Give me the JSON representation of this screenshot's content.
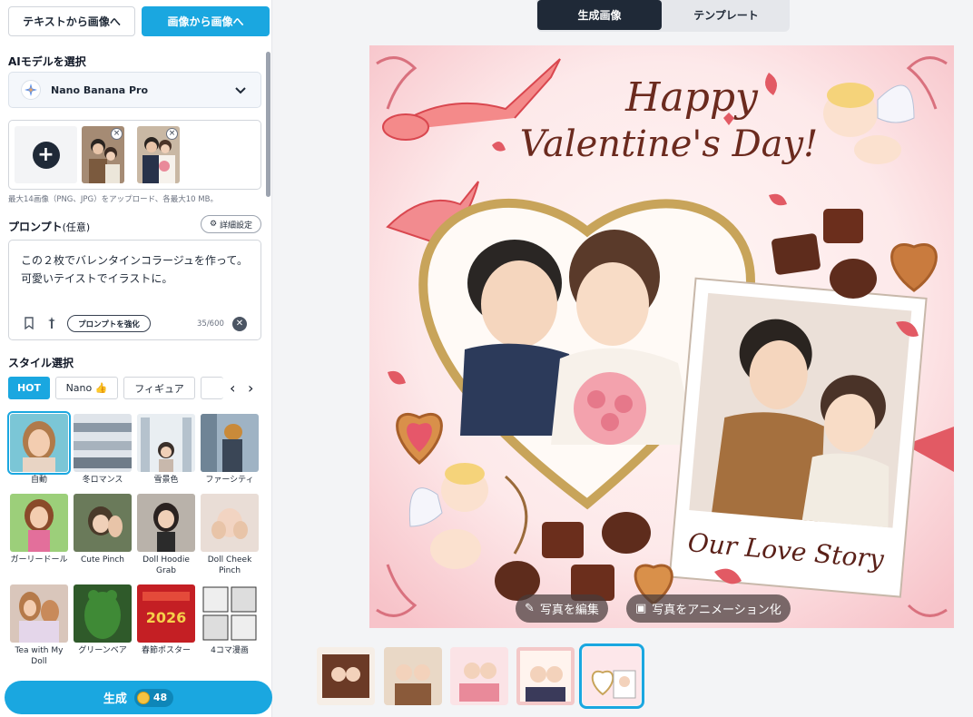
{
  "mode_tabs": {
    "text_to_image": "テキストから画像へ",
    "image_to_image": "画像から画像へ"
  },
  "model": {
    "section_label": "AIモデルを選択",
    "selected": "Nano Banana Pro"
  },
  "upload": {
    "note": "最大14画像（PNG、JPG）をアップロード、各最大10 MB。",
    "thumbnail_count": 2
  },
  "prompt": {
    "label": "プロンプト",
    "optional": "(任意)",
    "detail_settings": "詳細設定",
    "text": "この２枚でバレンタインコラージュを作って。可愛いテイストでイラストに。",
    "enhance_label": "プロンプトを強化",
    "counter": "35/600"
  },
  "style": {
    "section_label": "スタイル選択",
    "chips": [
      "HOT",
      "Nano 👍",
      "フィギュア"
    ],
    "items": [
      {
        "label": "自動",
        "selected": true
      },
      {
        "label": "冬ロマンス"
      },
      {
        "label": "雪景色"
      },
      {
        "label": "ファーシティ"
      },
      {
        "label": "ガーリードール"
      },
      {
        "label": "Cute Pinch"
      },
      {
        "label": "Doll Hoodie Grab"
      },
      {
        "label": "Doll Cheek Pinch"
      },
      {
        "label": "Tea with My Doll"
      },
      {
        "label": "グリーンベア"
      },
      {
        "label": "春節ポスター"
      },
      {
        "label": "4コマ漫画"
      }
    ]
  },
  "generate": {
    "label": "生成",
    "credits": "48"
  },
  "view_tabs": {
    "generated": "生成画像",
    "templates": "テンプレート"
  },
  "image": {
    "headline_1": "Happy",
    "headline_2": "Valentine's Day!",
    "caption": "Our Love Story",
    "edit_label": "写真を編集",
    "animate_label": "写真をアニメーション化"
  },
  "history": {
    "count": 5,
    "selected_index": 4
  },
  "colors": {
    "accent": "#1aa7e0",
    "dark": "#1f2937"
  }
}
